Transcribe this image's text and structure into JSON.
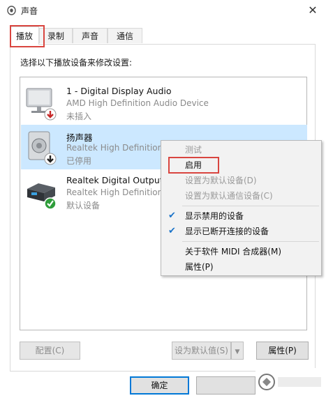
{
  "window": {
    "title": "声音",
    "close_glyph": "✕"
  },
  "tabs": [
    {
      "label": "播放",
      "active": true
    },
    {
      "label": "录制"
    },
    {
      "label": "声音"
    },
    {
      "label": "通信"
    }
  ],
  "instruction": "选择以下播放设备来修改设置:",
  "devices": [
    {
      "name": "1 - Digital Display Audio",
      "description": "AMD High Definition Audio Device",
      "status": "未插入",
      "icon": "monitor-icon",
      "badge": "red-down-arrow"
    },
    {
      "name": "扬声器",
      "description": "Realtek High Definition",
      "status": "已停用",
      "icon": "speaker-icon",
      "badge": "black-down-arrow",
      "selected": true
    },
    {
      "name": "Realtek Digital Output",
      "description": "Realtek High Definition",
      "status": "默认设备",
      "icon": "digital-output-icon",
      "badge": "green-check"
    }
  ],
  "context_menu": {
    "items": [
      {
        "label": "测试",
        "disabled": true
      },
      {
        "label": "启用"
      },
      {
        "label": "设置为默认设备(D)",
        "disabled": true
      },
      {
        "label": "设置为默认通信设备(C)",
        "disabled": true
      },
      {
        "label": "显示禁用的设备",
        "checked": true
      },
      {
        "label": "显示已断开连接的设备",
        "checked": true
      },
      {
        "label": "关于软件 MIDI 合成器(M)"
      },
      {
        "label": "属性(P)"
      }
    ]
  },
  "buttons": {
    "configure": "配置(C)",
    "set_default": "设为默认值(S)",
    "properties": "属性(P)",
    "ok": "确定"
  },
  "colors": {
    "selection": "#cce8ff",
    "highlight_box": "#d9453f",
    "check": "#1a73c9"
  }
}
